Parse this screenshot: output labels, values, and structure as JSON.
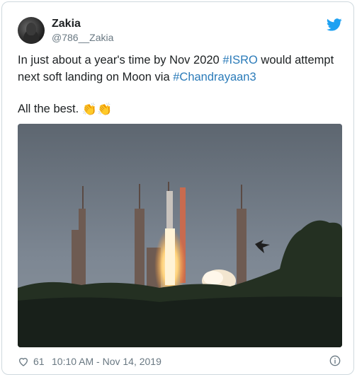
{
  "user": {
    "name": "Zakia",
    "handle": "@786__Zakia"
  },
  "tweet": {
    "line1_pre": "In just about a year's time by Nov 2020 ",
    "tag1": "#ISRO",
    "line1_post": " would attempt next soft landing on Moon via ",
    "tag2": "#Chandrayaan3",
    "line2": "All the best.",
    "emoji": "👏👏"
  },
  "footer": {
    "likes": "61",
    "timestamp": "10:10 AM - Nov 14, 2019"
  },
  "icons": [
    "twitter-bird-icon",
    "heart-icon",
    "info-icon"
  ],
  "colors": {
    "link": "#2b7bb9",
    "twitter_blue": "#1da1f2",
    "muted": "#697882"
  }
}
